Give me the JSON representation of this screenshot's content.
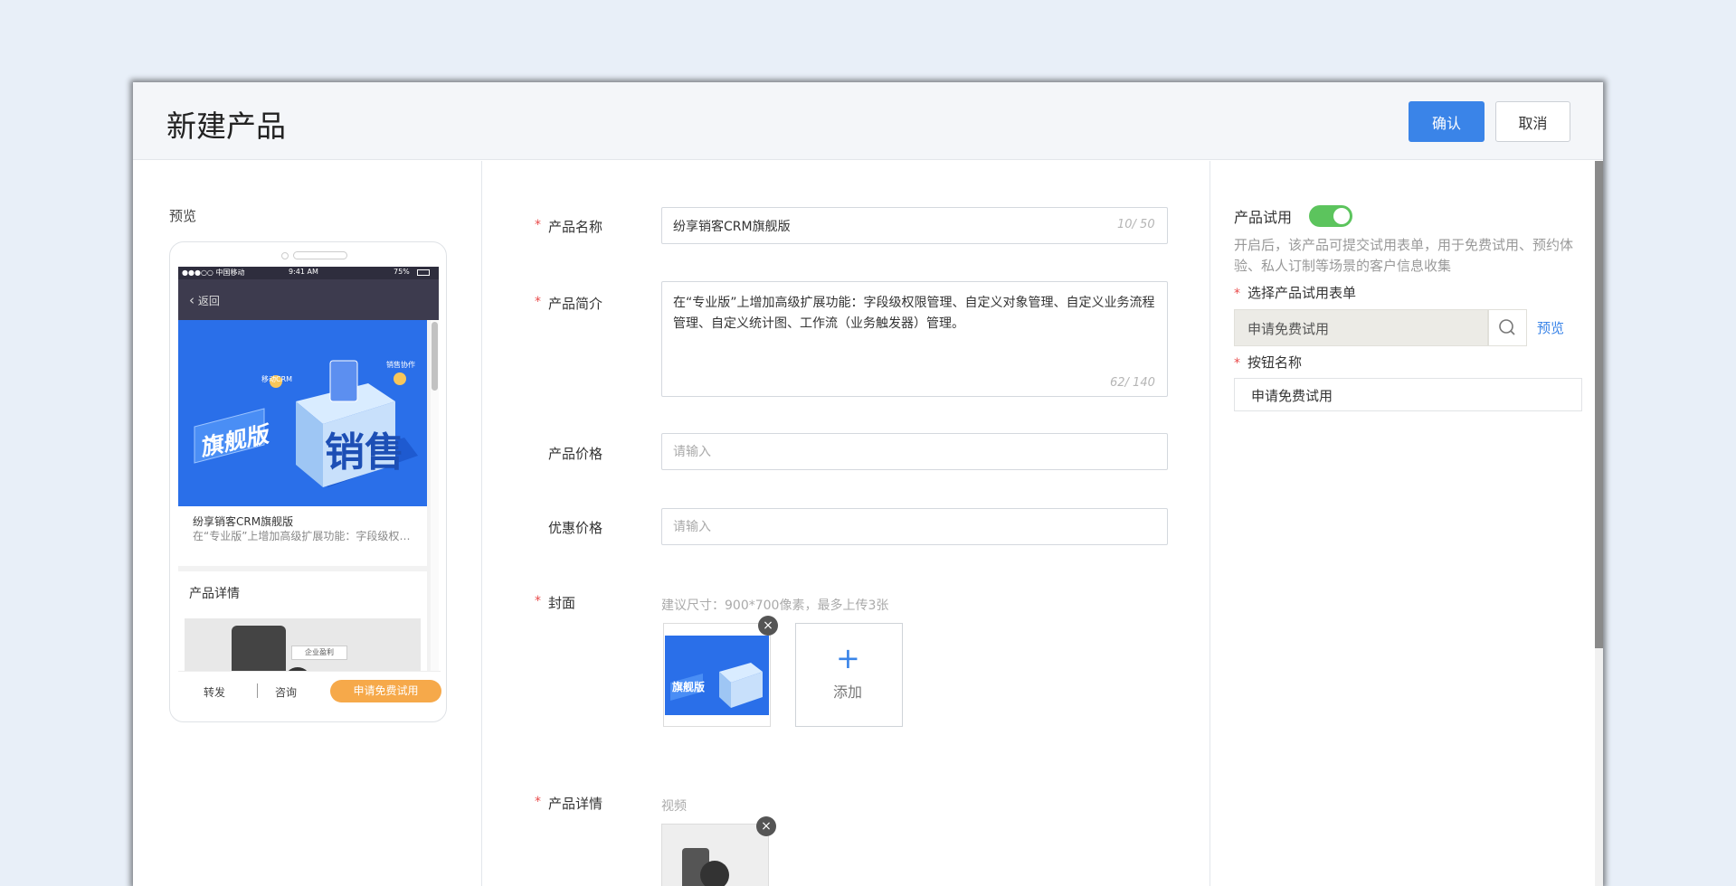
{
  "dialog": {
    "title": "新建产品",
    "confirm_label": "确认",
    "cancel_label": "取消"
  },
  "preview": {
    "label": "预览",
    "status": {
      "carrier": "●●●○○ 中国移动",
      "time": "9:41 AM",
      "battery": "75%"
    },
    "nav_back": "返回",
    "banner_badge": "旗舰版",
    "banner_big": "销售",
    "banner_tag1": "移动CRM",
    "banner_tag2": "销售协作",
    "product_name": "纷享销客CRM旗舰版",
    "product_desc": "在“专业版”上增加高级扩展功能：字段级权限管理、自定义对象管理",
    "detail_title": "产品详情",
    "detail_img_caption": "企业盈利",
    "bottom": {
      "forward": "转发",
      "consult": "咨询",
      "trial": "申请免费试用"
    }
  },
  "form": {
    "name": {
      "label": "产品名称",
      "value": "纷享销客CRM旗舰版",
      "counter": "10/ 50"
    },
    "intro": {
      "label": "产品简介",
      "value": "在“专业版”上增加高级扩展功能：字段级权限管理、自定义对象管理、自定义业务流程管理、自定义统计图、工作流（业务触发器）管理。",
      "counter": "62/ 140"
    },
    "price": {
      "label": "产品价格",
      "placeholder": "请输入"
    },
    "discount": {
      "label": "优惠价格",
      "placeholder": "请输入"
    },
    "cover": {
      "label": "封面",
      "hint": "建议尺寸：900*700像素，最多上传3张",
      "add_label": "添加",
      "thumb_badge": "旗舰版"
    },
    "detail": {
      "label": "产品详情",
      "video_label": "视频"
    }
  },
  "trial": {
    "label": "产品试用",
    "enabled": true,
    "description": "开启后，该产品可提交试用表单，用于免费试用、预约体验、私人订制等场景的客户信息收集",
    "select_label": "选择产品试用表单",
    "select_value": "申请免费试用",
    "preview_link": "预览",
    "button_name_label": "按钮名称",
    "button_name_value": "申请免费试用"
  },
  "colors": {
    "primary": "#3a84e8",
    "toggle_on": "#5cc45d",
    "trial_button": "#f6a94a",
    "required": "#e94b4b"
  }
}
